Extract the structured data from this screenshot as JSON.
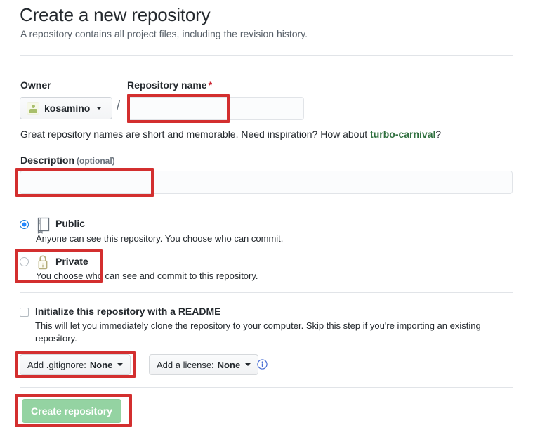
{
  "header": {
    "title": "Create a new repository",
    "subtitle": "A repository contains all project files, including the revision history."
  },
  "owner": {
    "label": "Owner",
    "name": "kosamino",
    "avatar_icon": "user-avatar-icon",
    "separator": "/"
  },
  "repo_name": {
    "label": "Repository name",
    "required_marker": "*",
    "value": "",
    "placeholder": "",
    "hint_prefix": "Great repository names are short and memorable. Need inspiration? How about ",
    "hint_suggestion": "turbo-carnival",
    "hint_suffix": "?"
  },
  "description": {
    "label": "Description",
    "optional_note": "(optional)",
    "value": "",
    "placeholder": ""
  },
  "visibility": {
    "selected": "public",
    "options": [
      {
        "id": "public",
        "icon": "book-icon",
        "title": "Public",
        "description": "Anyone can see this repository. You choose who can commit.",
        "checked": true
      },
      {
        "id": "private",
        "icon": "lock-icon",
        "title": "Private",
        "description": "You choose who can see and commit to this repository.",
        "checked": false
      }
    ]
  },
  "readme": {
    "title": "Initialize this repository with a README",
    "description": "This will let you immediately clone the repository to your computer. Skip this step if you're importing an existing repository.",
    "checked": false
  },
  "gitignore": {
    "label": "Add .gitignore:",
    "value": "None"
  },
  "license": {
    "label": "Add a license:",
    "value": "None",
    "info_icon": "info-circle-icon"
  },
  "submit": {
    "label": "Create repository",
    "enabled": false
  },
  "colors": {
    "annotation_red": "#d32f2f",
    "accent_blue": "#2188ff",
    "suggestion_green": "#2f6f3e",
    "button_green": "#94d3a2",
    "required_red": "#cb2431",
    "divider": "#e1e4e8",
    "muted_text": "#586069"
  },
  "annotations": [
    {
      "name": "repo-name-highlight",
      "target": "repository-name-input"
    },
    {
      "name": "description-highlight",
      "target": "description-input"
    },
    {
      "name": "private-highlight",
      "target": "visibility-option-private"
    },
    {
      "name": "gitignore-highlight",
      "target": "gitignore-dropdown"
    },
    {
      "name": "create-repository-highlight",
      "target": "create-repository-button"
    }
  ]
}
